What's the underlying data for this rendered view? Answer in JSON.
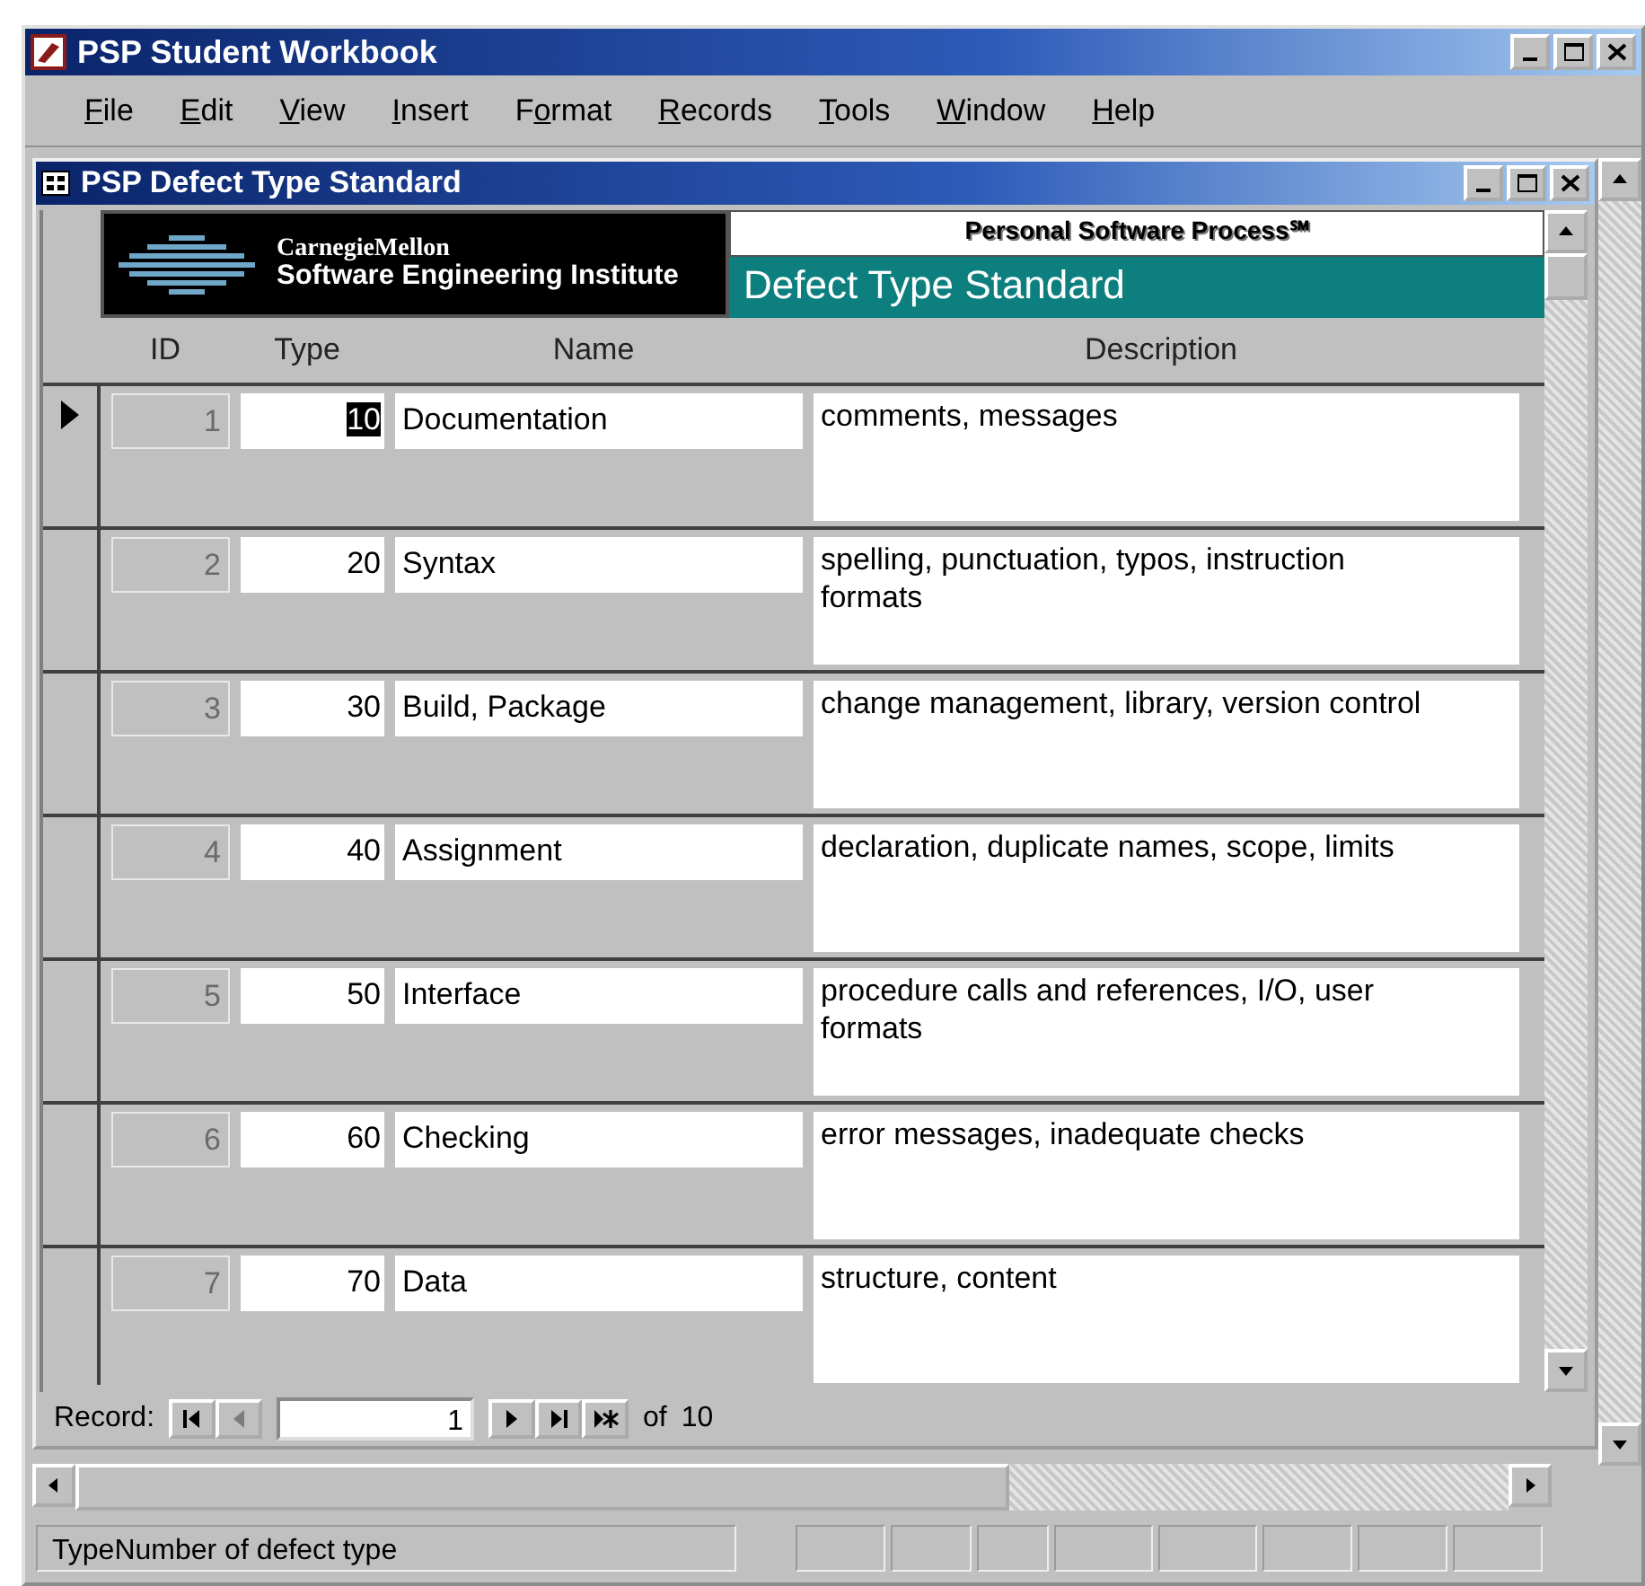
{
  "window": {
    "title": "PSP Student Workbook"
  },
  "menu": [
    {
      "key": "F",
      "post": "ile"
    },
    {
      "key": "E",
      "post": "dit"
    },
    {
      "key": "V",
      "post": "iew"
    },
    {
      "key": "I",
      "post": "nsert"
    },
    {
      "pre": "F",
      "key": "o",
      "post": "rmat"
    },
    {
      "key": "R",
      "post": "ecords"
    },
    {
      "key": "T",
      "post": "ools"
    },
    {
      "key": "W",
      "post": "indow"
    },
    {
      "key": "H",
      "post": "elp"
    }
  ],
  "child_window": {
    "title": "PSP Defect Type Standard"
  },
  "header": {
    "logo_line1": "CarnegieMellon",
    "logo_line2": "Software Engineering Institute",
    "banner": "Personal Software Process℠",
    "title": "Defect Type Standard"
  },
  "columns": [
    "ID",
    "Type",
    "Name",
    "Description"
  ],
  "rows": [
    {
      "id": "1",
      "type": "10",
      "name": "Documentation",
      "description": "comments, messages",
      "selected": true
    },
    {
      "id": "2",
      "type": "20",
      "name": "Syntax",
      "description": "spelling, punctuation, typos, instruction formats",
      "selected": false
    },
    {
      "id": "3",
      "type": "30",
      "name": "Build, Package",
      "description": "change management, library, version control",
      "selected": false
    },
    {
      "id": "4",
      "type": "40",
      "name": "Assignment",
      "description": "declaration, duplicate names, scope, limits",
      "selected": false
    },
    {
      "id": "5",
      "type": "50",
      "name": "Interface",
      "description": "procedure calls and references, I/O, user formats",
      "selected": false
    },
    {
      "id": "6",
      "type": "60",
      "name": "Checking",
      "description": "error messages, inadequate checks",
      "selected": false
    },
    {
      "id": "7",
      "type": "70",
      "name": "Data",
      "description": "structure, content",
      "selected": false
    }
  ],
  "navigator": {
    "label": "Record:",
    "current": "1",
    "of_label": "of",
    "total": "10",
    "buttons": [
      {
        "kind": "first",
        "disabled": false
      },
      {
        "kind": "prev",
        "disabled": true
      }
    ],
    "buttons_after": [
      {
        "kind": "next",
        "disabled": false
      },
      {
        "kind": "last",
        "disabled": false
      },
      {
        "kind": "new",
        "disabled": false
      }
    ]
  },
  "status_bar": {
    "text": "TypeNumber of defect type"
  }
}
